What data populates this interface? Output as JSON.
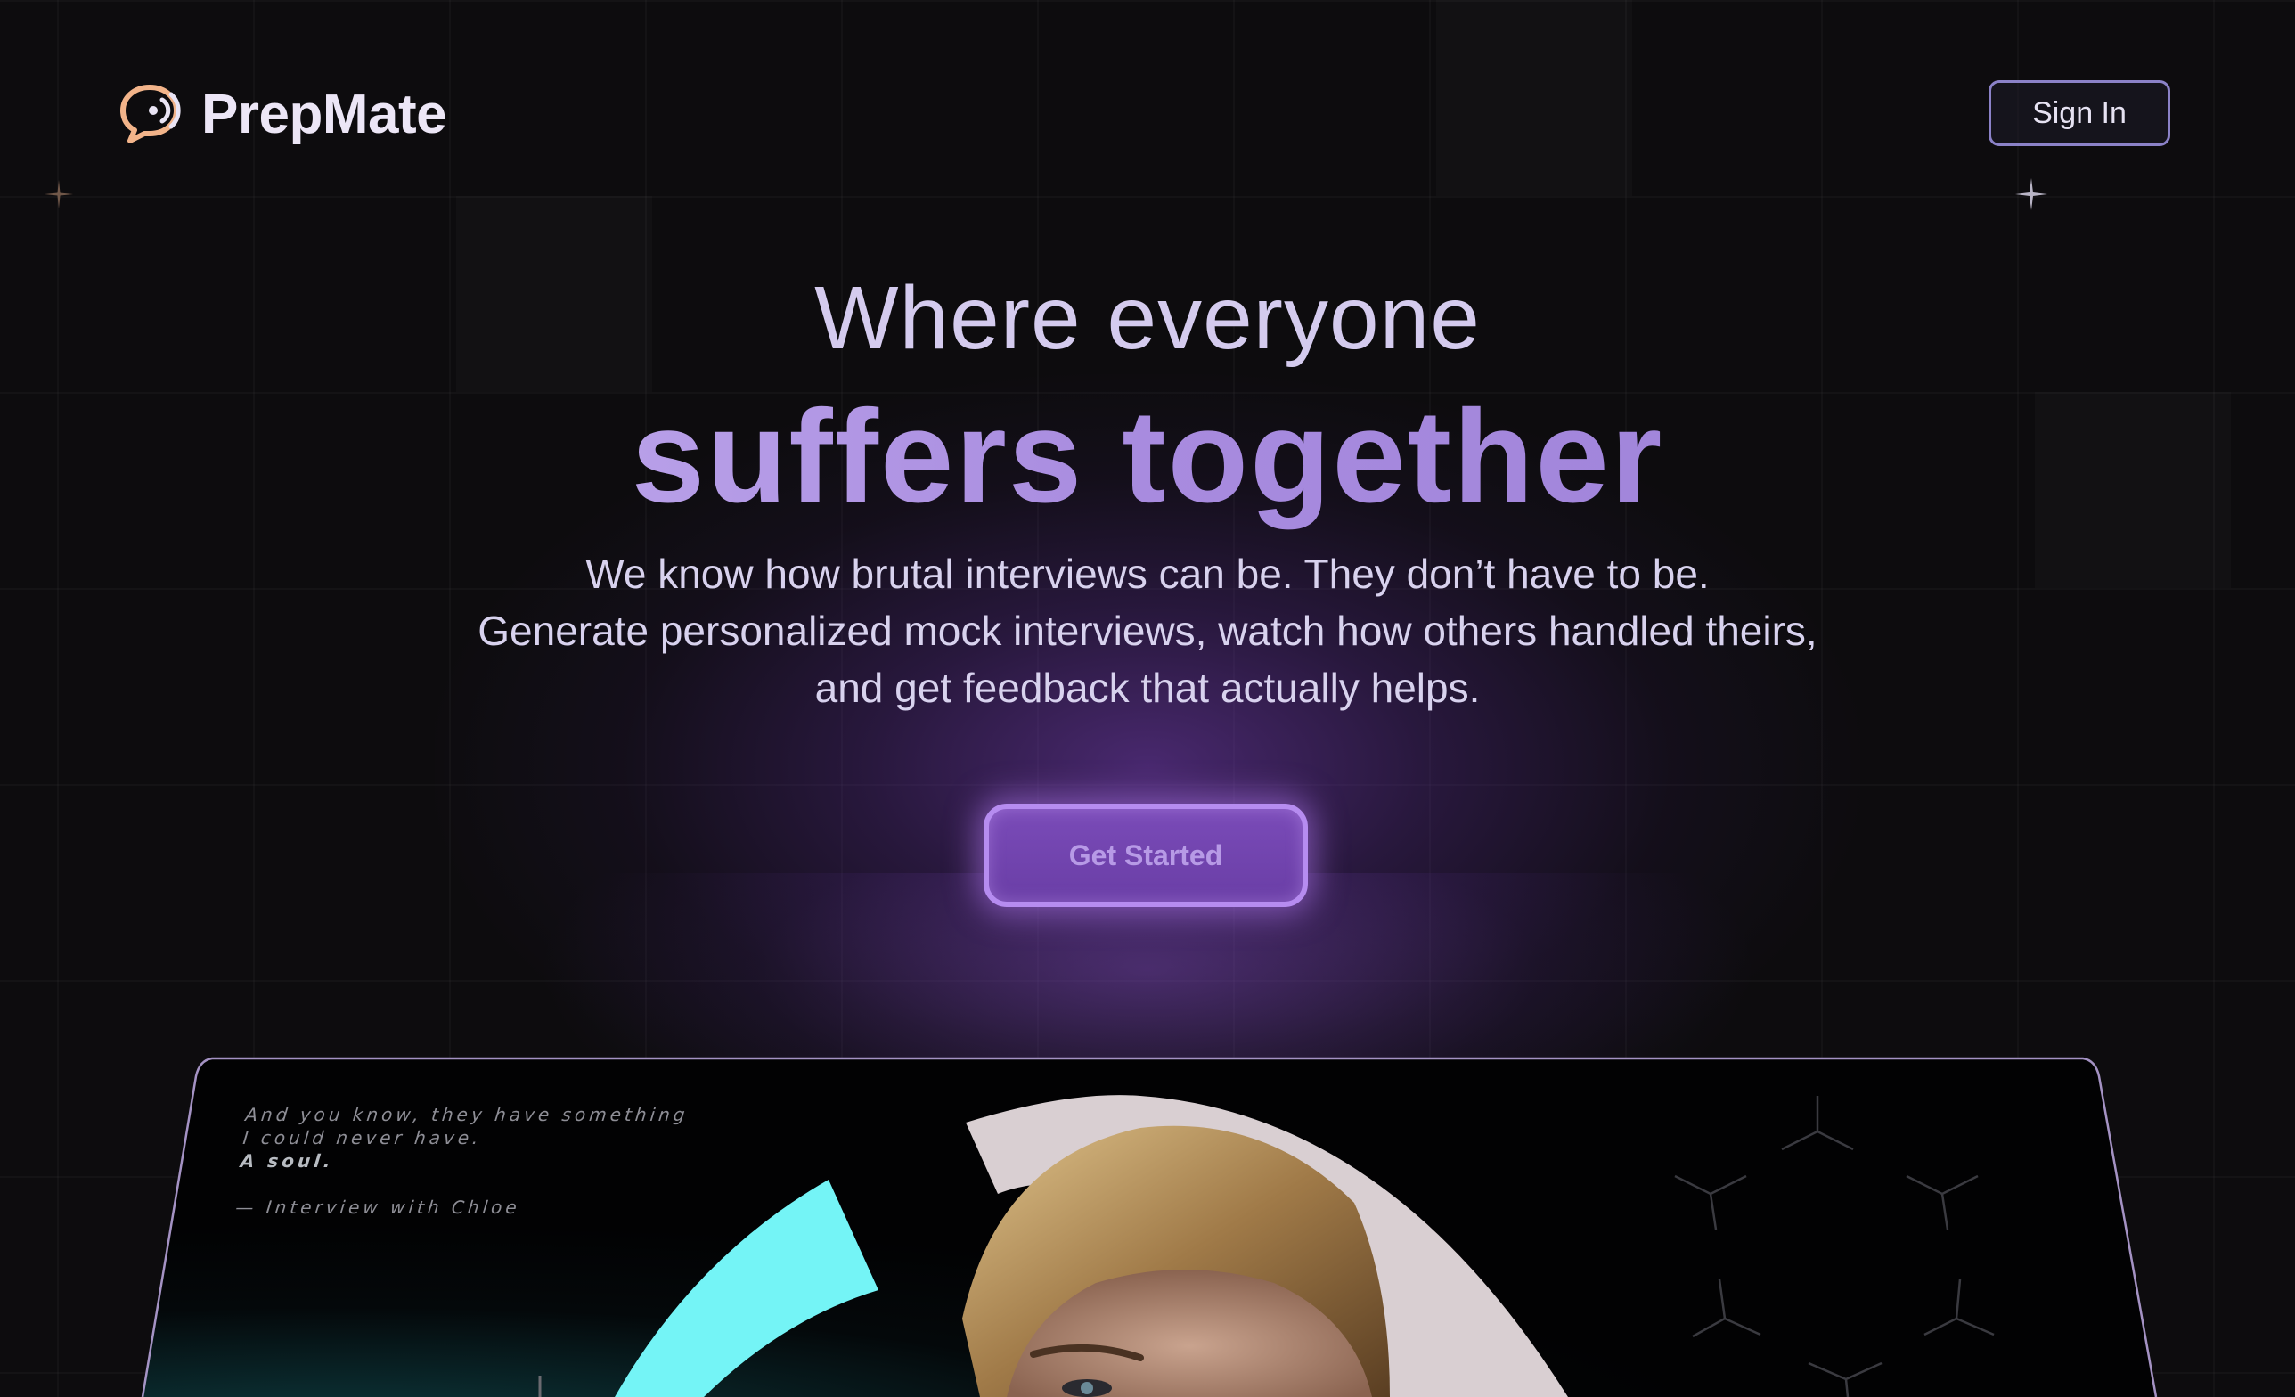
{
  "brand": {
    "name": "PrepMate",
    "logo_icon": "chat-bubble-audio-icon",
    "accent": "#f2b48a"
  },
  "header": {
    "sign_in_label": "Sign In"
  },
  "hero": {
    "line1": "Where everyone",
    "line2": "suffers together",
    "subtitle_lines": [
      "We know how brutal interviews can be. They don’t have to be.",
      "Generate personalized mock interviews, watch how others handled theirs,",
      "and get feedback that actually helps."
    ],
    "cta_label": "Get Started"
  },
  "preview": {
    "quote_lines": [
      "And you know, they have something",
      "I could never have.",
      "A soul."
    ],
    "attribution": "— Interview with Chloe"
  },
  "colors": {
    "background": "#0d0c0e",
    "purple_accent": "#a98ce0",
    "cta_border": "#b68cf0",
    "signin_border": "#8b82c8",
    "cyan_arc": "#74f4f6"
  }
}
